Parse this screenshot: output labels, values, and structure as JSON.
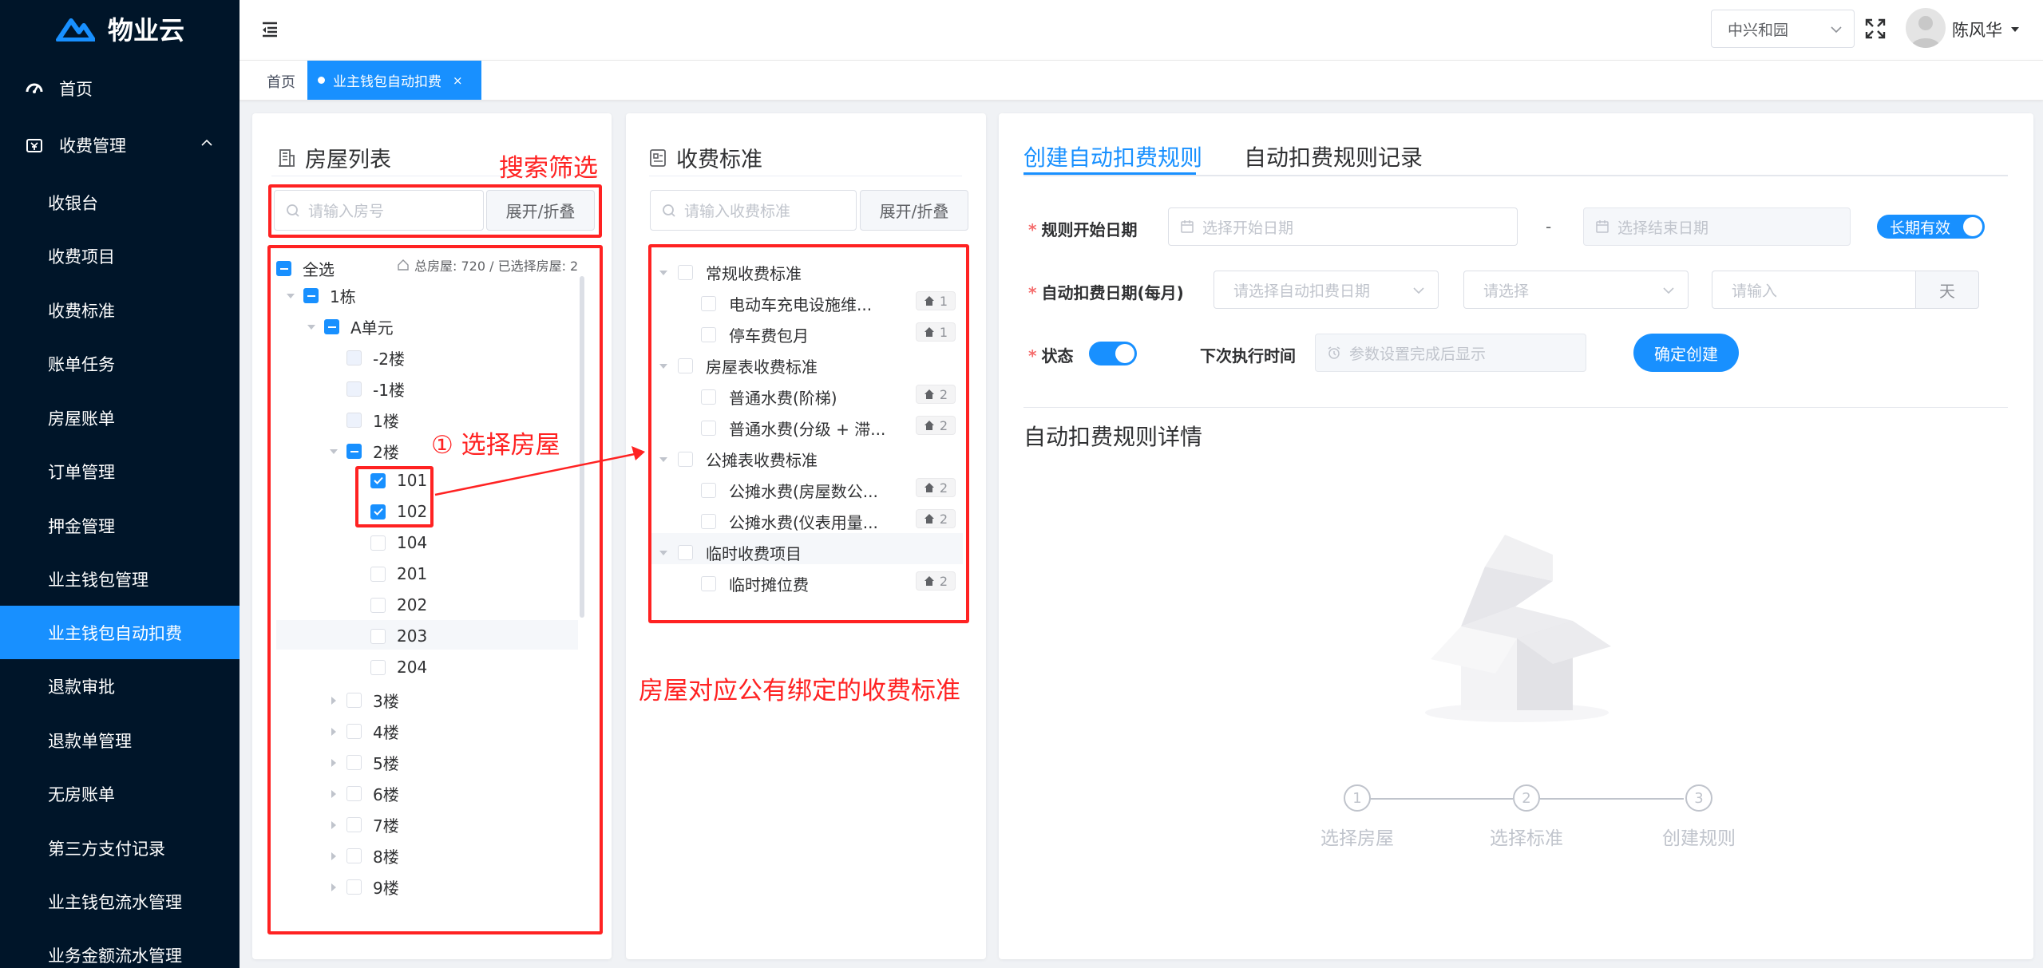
{
  "app": {
    "name": "物业云"
  },
  "sidebar": {
    "items": [
      {
        "label": "首页",
        "icon": "dashboard-icon"
      },
      {
        "label": "收费管理",
        "icon": "wallet-icon"
      },
      {
        "label": "收银台"
      },
      {
        "label": "收费项目"
      },
      {
        "label": "收费标准"
      },
      {
        "label": "账单任务"
      },
      {
        "label": "房屋账单"
      },
      {
        "label": "订单管理"
      },
      {
        "label": "押金管理"
      },
      {
        "label": "业主钱包管理"
      },
      {
        "label": "业主钱包自动扣费"
      },
      {
        "label": "退款审批"
      },
      {
        "label": "退款单管理"
      },
      {
        "label": "无房账单"
      },
      {
        "label": "第三方支付记录"
      },
      {
        "label": "业主钱包流水管理"
      },
      {
        "label": "业务金额流水管理"
      }
    ]
  },
  "header": {
    "community": "中兴和园",
    "user": "陈风华"
  },
  "tags": {
    "home": "首页",
    "current": "业主钱包自动扣费"
  },
  "house_panel": {
    "title": "房屋列表",
    "search_placeholder": "请输入房号",
    "toggle_label": "展开/折叠",
    "select_all": "全选",
    "summary": "总房屋: 720 / 已选择房屋: 2",
    "building": "1栋",
    "unit": "A单元",
    "floors_top": [
      "-2楼",
      "-1楼",
      "1楼"
    ],
    "floor_open": "2楼",
    "rooms": [
      {
        "no": "101",
        "checked": true
      },
      {
        "no": "102",
        "checked": true
      },
      {
        "no": "104",
        "checked": false
      },
      {
        "no": "201",
        "checked": false
      },
      {
        "no": "202",
        "checked": false
      },
      {
        "no": "203",
        "checked": false
      },
      {
        "no": "204",
        "checked": false
      }
    ],
    "floors_bottom": [
      "3楼",
      "4楼",
      "5楼",
      "6楼",
      "7楼",
      "8楼",
      "9楼"
    ]
  },
  "fee_panel": {
    "title": "收费标准",
    "search_placeholder": "请输入收费标准",
    "toggle_label": "展开/折叠",
    "groups": [
      {
        "name": "常规收费标准",
        "items": [
          {
            "name": "电动车充电设施维...",
            "count": "1"
          },
          {
            "name": "停车费包月",
            "count": "1"
          }
        ]
      },
      {
        "name": "房屋表收费标准",
        "items": [
          {
            "name": "普通水费(阶梯)",
            "count": "2"
          },
          {
            "name": "普通水费(分级 + 滞...",
            "count": "2"
          }
        ]
      },
      {
        "name": "公摊表收费标准",
        "items": [
          {
            "name": "公摊水费(房屋数公...",
            "count": "2"
          },
          {
            "name": "公摊水费(仪表用量...",
            "count": "2"
          }
        ]
      },
      {
        "name": "临时收费项目",
        "items": [
          {
            "name": "临时摊位费",
            "count": "2"
          }
        ]
      }
    ]
  },
  "rule_panel": {
    "tabs": [
      "创建自动扣费规则",
      "自动扣费规则记录"
    ],
    "start_date_label": "规则开始日期",
    "start_placeholder": "选择开始日期",
    "date_sep": "-",
    "end_placeholder": "选择结束日期",
    "long_valid_label": "长期有效",
    "deduct_date_label": "自动扣费日期(每月)",
    "deduct_day_placeholder": "请选择自动扣费日期",
    "deduct_select_placeholder": "请选择",
    "deduct_input_placeholder": "请输入",
    "deduct_unit": "天",
    "status_label": "状态",
    "next_exec_label": "下次执行时间",
    "next_exec_placeholder": "参数设置完成后显示",
    "create_button": "确定创建",
    "detail_title": "自动扣费规则详情",
    "steps": [
      {
        "num": "1",
        "label": "选择房屋"
      },
      {
        "num": "2",
        "label": "选择标准"
      },
      {
        "num": "3",
        "label": "创建规则"
      }
    ]
  },
  "annotations": {
    "search_filter": "搜索筛选",
    "select_house": "① 选择房屋",
    "bound_standards": "房屋对应公有绑定的收费标准"
  },
  "colors": {
    "sidebar_bg": "#001529",
    "accent": "#1890ff",
    "annotation": "#ff2222"
  }
}
